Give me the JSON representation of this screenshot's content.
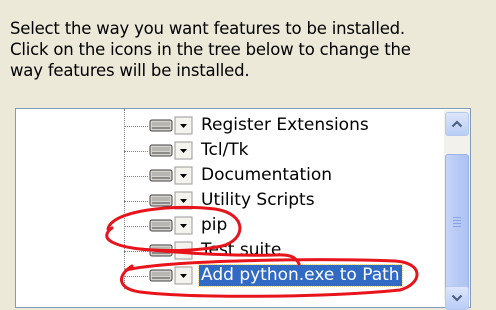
{
  "instructions": [
    "Select the way you want features to be installed.",
    "Click on the icons in the tree below to change the",
    "way features will be installed."
  ],
  "tree": {
    "items": [
      {
        "label": "Register Extensions",
        "icon": "drive-dropdown-icon"
      },
      {
        "label": "Tcl/Tk",
        "icon": "drive-dropdown-icon"
      },
      {
        "label": "Documentation",
        "icon": "drive-dropdown-icon"
      },
      {
        "label": "Utility Scripts",
        "icon": "drive-dropdown-icon"
      },
      {
        "label": "pip",
        "icon": "drive-dropdown-icon"
      },
      {
        "label": "Test suite",
        "icon": "drive-dropdown-icon"
      },
      {
        "label": "Add python.exe to Path",
        "icon": "drive-dropdown-icon",
        "selected": true
      }
    ]
  },
  "scrollbar": {
    "up_icon": "chevron-up-icon",
    "down_icon": "chevron-down-icon"
  },
  "annotations": {
    "color": "#E8141C",
    "marked_items": [
      "pip",
      "Add python.exe to Path"
    ]
  }
}
